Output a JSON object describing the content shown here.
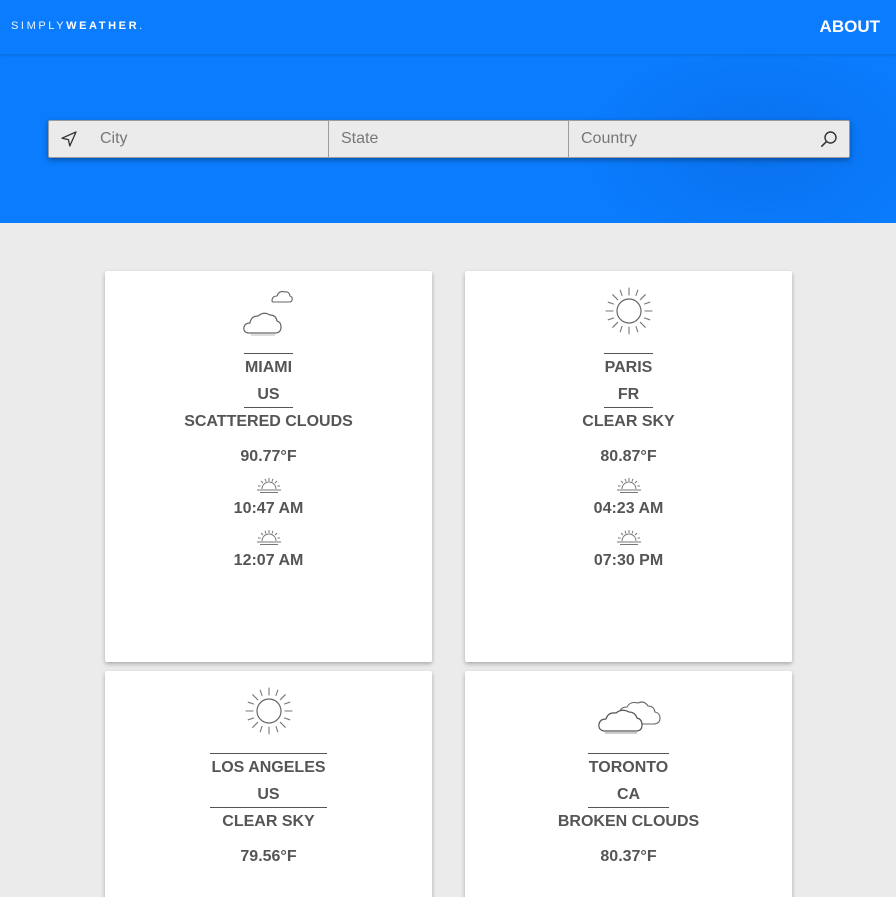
{
  "header": {
    "brand_light": "SIMPLY",
    "brand_bold": "WEATHER",
    "brand_dot": ".",
    "about_label": "ABOUT"
  },
  "colors": {
    "primary": "#0a7cfd",
    "background": "#ebebeb",
    "text": "#555555"
  },
  "search": {
    "location_icon": "location-arrow-icon",
    "search_icon": "search-icon",
    "city_placeholder": "City",
    "state_placeholder": "State",
    "country_placeholder": "Country"
  },
  "cards": [
    {
      "icon": "scattered-clouds-icon",
      "city": "MIAMI",
      "country": "US",
      "description": "SCATTERED CLOUDS",
      "temperature": "90.77°F",
      "sunrise": "10:47 AM",
      "sunset": "12:07 AM"
    },
    {
      "icon": "clear-sky-icon",
      "city": "PARIS",
      "country": "FR",
      "description": "CLEAR SKY",
      "temperature": "80.87°F",
      "sunrise": "04:23 AM",
      "sunset": "07:30 PM"
    },
    {
      "icon": "clear-sky-icon",
      "city": "LOS ANGELES",
      "country": "US",
      "description": "CLEAR SKY",
      "temperature": "79.56°F"
    },
    {
      "icon": "broken-clouds-icon",
      "city": "TORONTO",
      "country": "CA",
      "description": "BROKEN CLOUDS",
      "temperature": "80.37°F"
    }
  ]
}
